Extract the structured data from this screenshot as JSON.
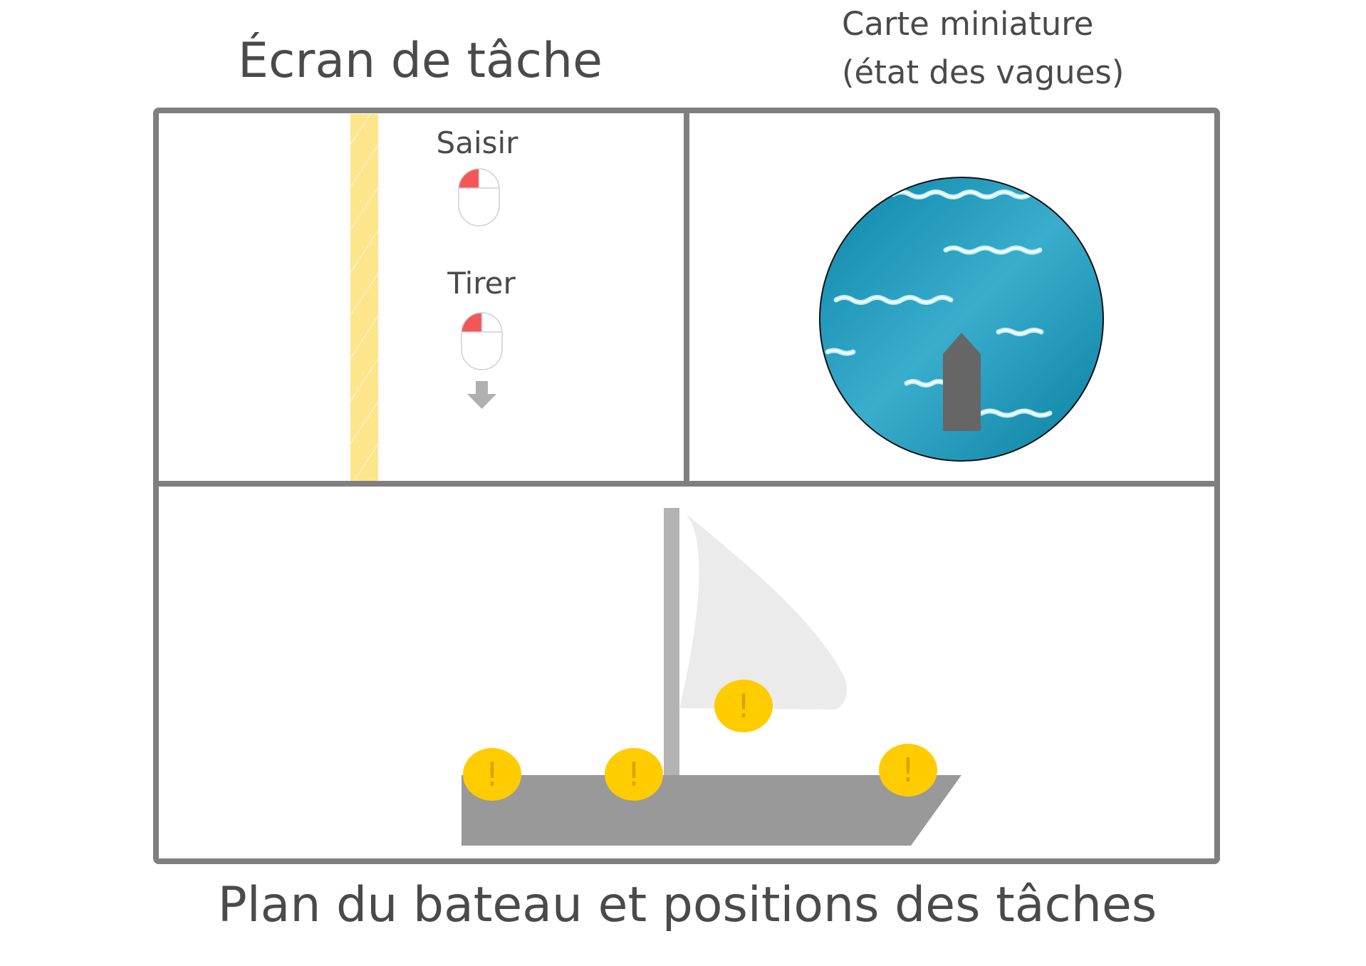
{
  "task_screen": {
    "title": "Écran de tâche",
    "actions": [
      {
        "label": "Saisir",
        "icon": "mouse-left-click-icon"
      },
      {
        "label": "Tirer",
        "icon": "mouse-left-click-icon",
        "gesture_icon": "arrow-down-icon"
      }
    ]
  },
  "minimap": {
    "title_line1": "Carte miniature",
    "title_line2": "(état des vagues)",
    "marker_icon": "boat-marker-icon"
  },
  "boat_plan": {
    "caption": "Plan du bateau et positions des tâches",
    "task_markers": [
      {
        "label": "!",
        "icon": "exclamation-icon"
      },
      {
        "label": "!",
        "icon": "exclamation-icon"
      },
      {
        "label": "!",
        "icon": "exclamation-icon"
      },
      {
        "label": "!",
        "icon": "exclamation-icon"
      }
    ]
  },
  "colors": {
    "frame": "#7f7f7f",
    "highlight_bar": "#fde58c",
    "mouse_button_active": "#f35656",
    "gesture_arrow": "#b0b0b0",
    "boat_marker": "#666666",
    "hull": "#999999",
    "mast": "#b3b3b3",
    "sail": "#ebebeb",
    "task_marker": "#ffcc00",
    "task_marker_text": "#dca300"
  }
}
